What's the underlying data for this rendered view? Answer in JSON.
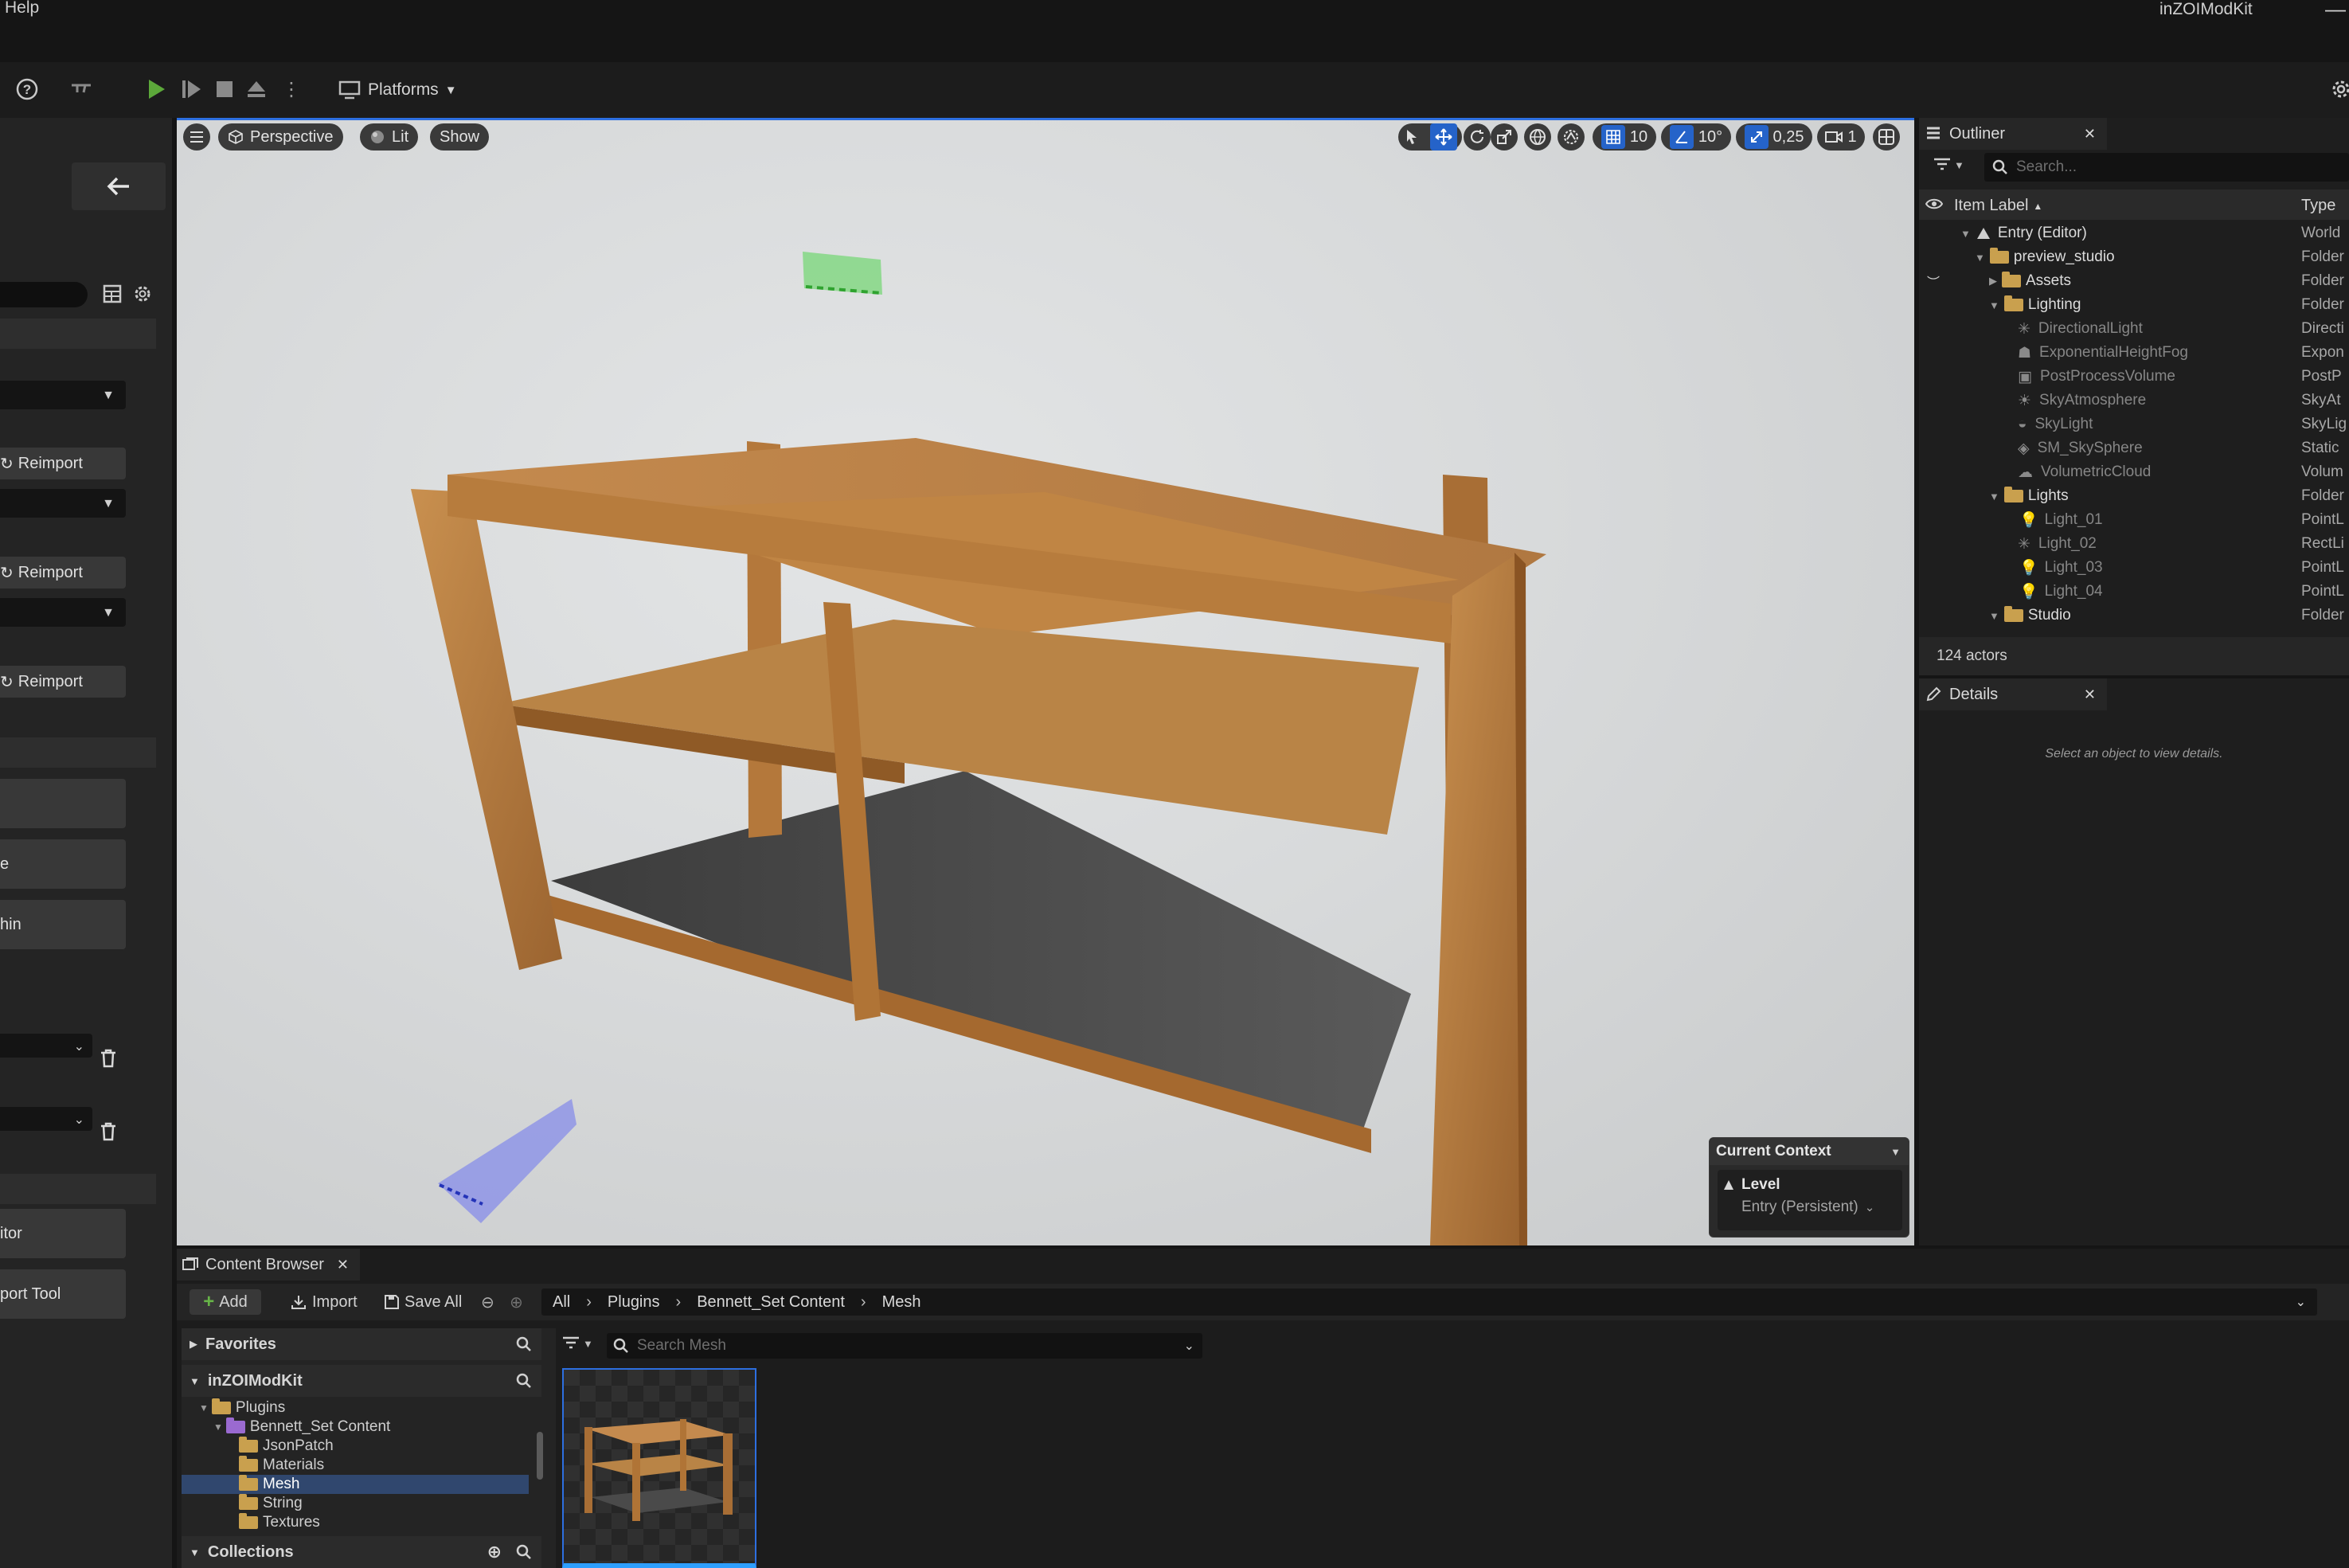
{
  "menubar": {
    "help": "Help",
    "app_title": "inZOIModKit",
    "minimize": "—"
  },
  "toolbar": {
    "platforms": "Platforms"
  },
  "left_panel": {
    "reimport": "Reimport",
    "button_text_1": "e",
    "button_text_2": "hin",
    "button_text_3": "itor",
    "button_text_4": "port Tool"
  },
  "viewport": {
    "perspective": "Perspective",
    "lit": "Lit",
    "show": "Show",
    "grid_snap": "10",
    "rotate_snap": "10°",
    "scale_snap": "0,25",
    "camera_speed": "1",
    "context": {
      "title": "Current Context",
      "level": "Level",
      "value": "Entry (Persistent)"
    }
  },
  "outliner": {
    "tab": "Outliner",
    "search_placeholder": "Search...",
    "col_label": "Item Label",
    "col_type": "Type",
    "rows": [
      {
        "label": "Entry (Editor)",
        "type": "World"
      },
      {
        "label": "preview_studio",
        "type": "Folder"
      },
      {
        "label": "Assets",
        "type": "Folder"
      },
      {
        "label": "Lighting",
        "type": "Folder"
      },
      {
        "label": "DirectionalLight",
        "type": "Directi"
      },
      {
        "label": "ExponentialHeightFog",
        "type": "Expon"
      },
      {
        "label": "PostProcessVolume",
        "type": "PostP"
      },
      {
        "label": "SkyAtmosphere",
        "type": "SkyAt"
      },
      {
        "label": "SkyLight",
        "type": "SkyLig"
      },
      {
        "label": "SM_SkySphere",
        "type": "Static"
      },
      {
        "label": "VolumetricCloud",
        "type": "Volum"
      },
      {
        "label": "Lights",
        "type": "Folder"
      },
      {
        "label": "Light_01",
        "type": "PointL"
      },
      {
        "label": "Light_02",
        "type": "RectLi"
      },
      {
        "label": "Light_03",
        "type": "PointL"
      },
      {
        "label": "Light_04",
        "type": "PointL"
      },
      {
        "label": "Studio",
        "type": "Folder"
      }
    ],
    "actors": "124 actors"
  },
  "details": {
    "tab": "Details",
    "empty": "Select an object to view details."
  },
  "content_browser": {
    "tab": "Content Browser",
    "add": "Add",
    "import": "Import",
    "save_all": "Save All",
    "breadcrumb": [
      "All",
      "Plugins",
      "Bennett_Set Content",
      "Mesh"
    ],
    "favorites": "Favorites",
    "project": "inZOIModKit",
    "tree": [
      "Plugins",
      "Bennett_Set Content",
      "JsonPatch",
      "Materials",
      "Mesh",
      "String",
      "Textures"
    ],
    "collections": "Collections",
    "search_placeholder": "Search Mesh"
  },
  "colors": {
    "accent": "#2563c9",
    "folder": "#c9a04e",
    "selected_row": "#30476e"
  }
}
